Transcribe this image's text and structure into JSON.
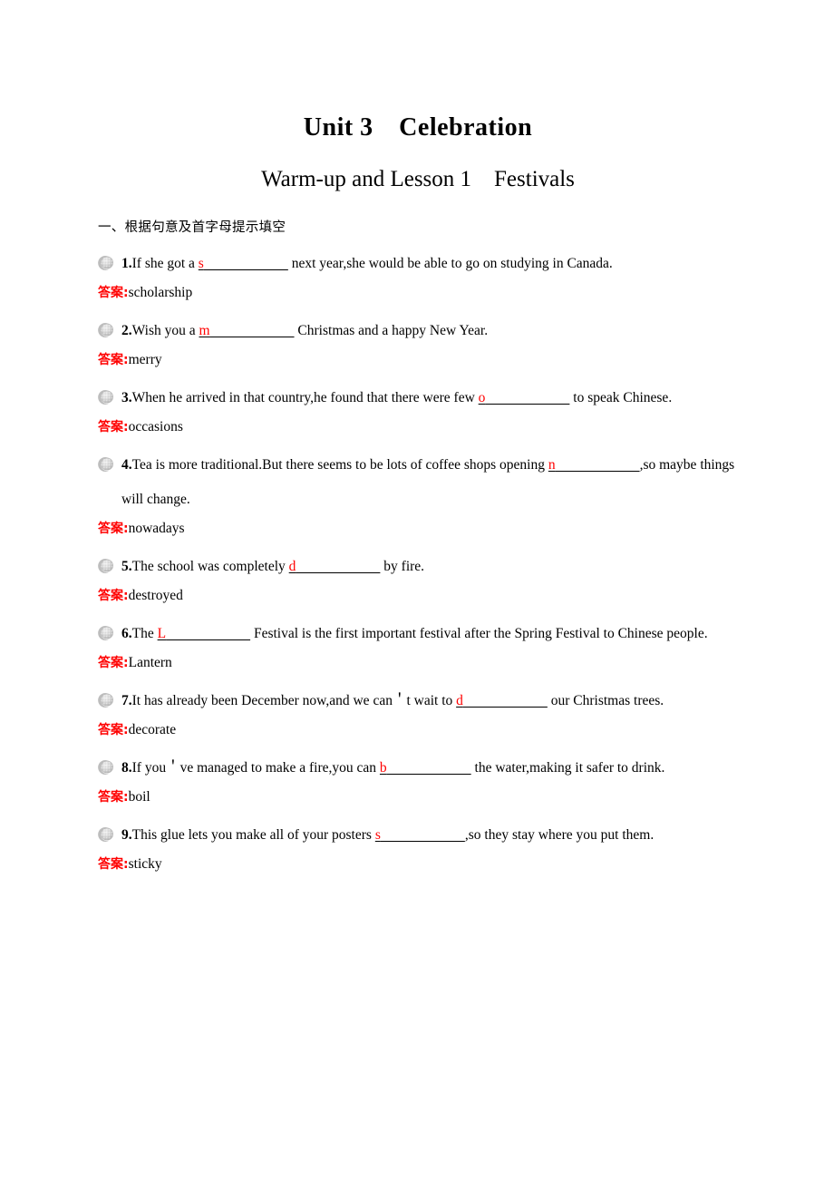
{
  "document": {
    "unit_title": "Unit 3 Celebration",
    "lesson_title": "Warm-up and Lesson 1 Festivals",
    "section_heading": "一、根据句意及首字母提示填空",
    "answer_label": "答案:",
    "colors": {
      "hint_red": "#ff0000",
      "answer_label_red": "#ff0000",
      "text_black": "#000000",
      "page_background": "#ffffff",
      "bullet_gray": "#c9c9c9"
    }
  },
  "questions": [
    {
      "number": "1.",
      "before": "If she got a ",
      "hint": "s",
      "rule": "____________",
      "after": " next year,she would be able to go on studying in Canada.",
      "answer_label": "答案:",
      "answer": "scholarship"
    },
    {
      "number": "2.",
      "before": "Wish you a ",
      "hint": "m",
      "rule": "____________",
      "after": " Christmas and a happy New Year.",
      "answer_label": "答案:",
      "answer": "merry"
    },
    {
      "number": "3.",
      "before": "When he arrived in that country,he found that there were few ",
      "hint": "o",
      "rule": "____________",
      "after": " to speak Chinese.",
      "answer_label": "答案:",
      "answer": "occasions"
    },
    {
      "number": "4.",
      "before": "Tea is more traditional.But there seems to be lots of coffee shops opening ",
      "hint": "n",
      "rule": "____________",
      "after": ",so maybe things will change.",
      "answer_label": "答案:",
      "answer": "nowadays"
    },
    {
      "number": "5.",
      "before": "The school was completely ",
      "hint": "d",
      "rule": "____________",
      "after": " by fire.",
      "answer_label": "答案:",
      "answer": "destroyed"
    },
    {
      "number": "6.",
      "before": "The ",
      "hint": "L",
      "rule": "____________",
      "after": " Festival is the first important festival after the Spring Festival to Chinese people.",
      "answer_label": "答案:",
      "answer": "Lantern"
    },
    {
      "number": "7.",
      "before": "It has already been December now,and we can＇t wait to ",
      "hint": "d",
      "rule": "____________",
      "after": " our Christmas trees.",
      "answer_label": "答案:",
      "answer": "decorate"
    },
    {
      "number": "8.",
      "before": "If you＇ve managed to make a fire,you can ",
      "hint": "b",
      "rule": "____________",
      "after": " the water,making it safer to drink.",
      "answer_label": "答案:",
      "answer": "boil"
    },
    {
      "number": "9.",
      "before": "This glue lets you make all of your posters ",
      "hint": "s",
      "rule": "____________",
      "after": ",so they stay where you put them.",
      "answer_label": "答案:",
      "answer": "sticky"
    }
  ]
}
